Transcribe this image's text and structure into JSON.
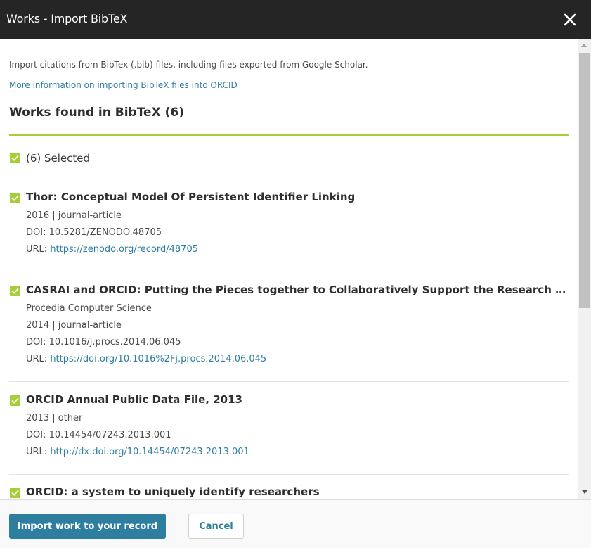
{
  "dialog": {
    "title": "Works - Import BibTeX",
    "close_icon": "close-icon"
  },
  "intro": {
    "text": "Import citations from BibTex (.bib) files, including files exported from Google Scholar.",
    "more_info_link": "More information on importing BibTeX files into ORCID"
  },
  "section": {
    "title": "Works found in BibTeX (6)",
    "selected_label": "(6) Selected"
  },
  "works": [
    {
      "title": "Thor: Conceptual Model Of Persistent Identifier Linking",
      "journal": "",
      "meta": "2016 | journal-article",
      "doi": "DOI: 10.5281/ZENODO.48705",
      "url_label": "URL: ",
      "url": "https://zenodo.org/record/48705"
    },
    {
      "title": "CASRAI and ORCID: Putting the Pieces together to Collaboratively Support the Research Comm...",
      "journal": "Procedia Computer Science",
      "meta": "2014 | journal-article",
      "doi": "DOI: 10.1016/j.procs.2014.06.045",
      "url_label": "URL: ",
      "url": "https://doi.org/10.1016%2Fj.procs.2014.06.045"
    },
    {
      "title": "ORCID Annual Public Data File, 2013",
      "journal": "",
      "meta": "2013 | other",
      "doi": "DOI: 10.14454/07243.2013.001",
      "url_label": "URL: ",
      "url": "http://dx.doi.org/10.14454/07243.2013.001"
    },
    {
      "title": "ORCID: a system to uniquely identify researchers"
    }
  ],
  "footer": {
    "import_button": "Import work to your record",
    "cancel_button": "Cancel"
  },
  "colors": {
    "titlebar": "#252525",
    "accent_green": "#a6ce39",
    "link_blue": "#2e7f9f",
    "primary_button": "#2e7f9f"
  }
}
